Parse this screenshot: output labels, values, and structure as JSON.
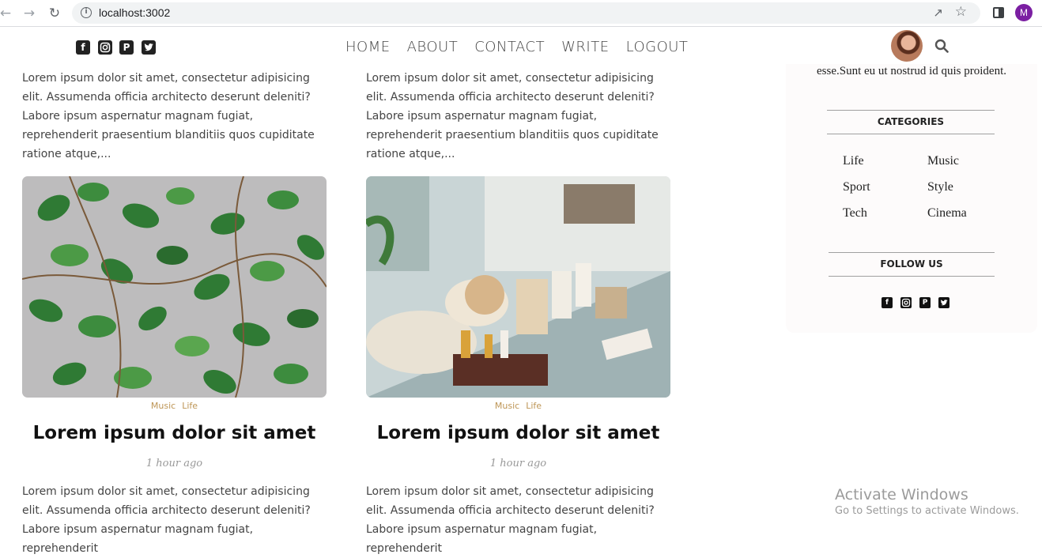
{
  "browser": {
    "url": "localhost:3002",
    "profile_initial": "M"
  },
  "header": {
    "social_icons": [
      "facebook-icon",
      "instagram-icon",
      "pinterest-icon",
      "twitter-icon"
    ],
    "menu": [
      "HOME",
      "ABOUT",
      "CONTACT",
      "WRITE",
      "LOGOUT"
    ]
  },
  "posts": {
    "excerpt": "Lorem ipsum dolor sit amet, consectetur adipisicing elit. Assumenda officia architecto deserunt deleniti? Labore ipsum aspernatur magnam fugiat, reprehenderit praesentium blanditiis quos cupiditate ratione atque,...",
    "excerpt_partial": "Lorem ipsum dolor sit amet, consectetur adipisicing elit. Assumenda officia architecto deserunt deleniti? Labore ipsum aspernatur magnam fugiat, reprehenderit",
    "items": [
      {
        "cats": [
          "Music",
          "Life"
        ],
        "title": "Lorem ipsum dolor sit amet",
        "date": "1 hour ago",
        "image": "green-vines-image"
      },
      {
        "cats": [
          "Music",
          "Life"
        ],
        "title": "Lorem ipsum dolor sit amet",
        "date": "1 hour ago",
        "image": "spa-shelf-image"
      }
    ]
  },
  "sidebar": {
    "about_tail": "esse.Sunt eu ut nostrud id quis proident.",
    "categories_title": "CATEGORIES",
    "categories": [
      "Life",
      "Music",
      "Sport",
      "Style",
      "Tech",
      "Cinema"
    ],
    "follow_title": "FOLLOW US"
  },
  "watermark": {
    "title": "Activate Windows",
    "subtitle": "Go to Settings to activate Windows."
  }
}
